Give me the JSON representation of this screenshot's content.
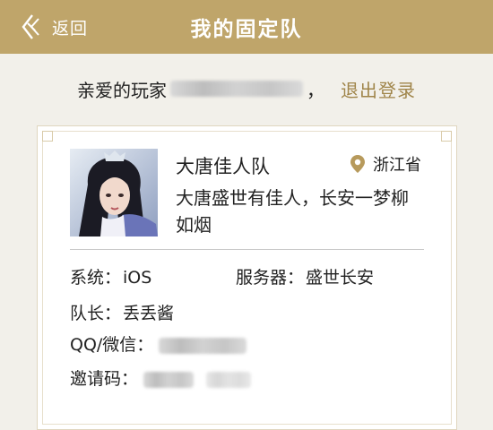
{
  "header": {
    "back_label": "返回",
    "title": "我的固定队"
  },
  "greeting": {
    "prefix": "亲爱的玩家",
    "suffix": "，",
    "logout_label": "退出登录"
  },
  "team": {
    "name": "大唐佳人队",
    "location": "浙江省",
    "slogan": "大唐盛世有佳人，长安一梦柳如烟",
    "system_label": "系统：",
    "system_value": "iOS",
    "server_label": "服务器：",
    "server_value": "盛世长安",
    "leader_label": "队长：",
    "leader_value": "丢丢酱",
    "qq_label": "QQ/微信：",
    "invite_label": "邀请码："
  },
  "colors": {
    "brand_gold": "#bfa56a",
    "link_gold": "#a0854a",
    "page_background": "#f2f0ea"
  },
  "icons": {
    "back": "back-arrow-icon",
    "location": "location-pin-icon"
  }
}
